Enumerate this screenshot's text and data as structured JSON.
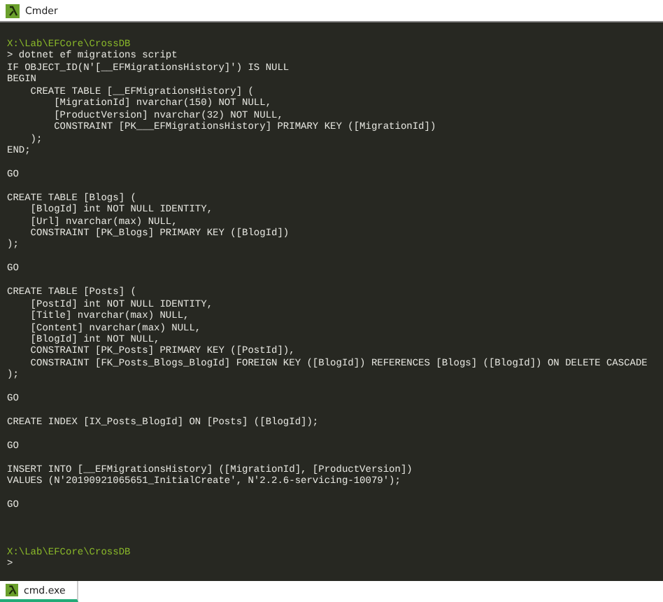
{
  "window": {
    "title": "Cmder"
  },
  "console": {
    "lines": [
      {
        "kind": "path",
        "text": "X:\\Lab\\EFCore\\CrossDB"
      },
      {
        "kind": "command",
        "text": "> dotnet ef migrations script"
      },
      {
        "kind": "output",
        "text": "IF OBJECT_ID(N'[__EFMigrationsHistory]') IS NULL"
      },
      {
        "kind": "output",
        "text": "BEGIN"
      },
      {
        "kind": "output",
        "text": "    CREATE TABLE [__EFMigrationsHistory] ("
      },
      {
        "kind": "output",
        "text": "        [MigrationId] nvarchar(150) NOT NULL,"
      },
      {
        "kind": "output",
        "text": "        [ProductVersion] nvarchar(32) NOT NULL,"
      },
      {
        "kind": "output",
        "text": "        CONSTRAINT [PK___EFMigrationsHistory] PRIMARY KEY ([MigrationId])"
      },
      {
        "kind": "output",
        "text": "    );"
      },
      {
        "kind": "output",
        "text": "END;"
      },
      {
        "kind": "blank"
      },
      {
        "kind": "output",
        "text": "GO"
      },
      {
        "kind": "blank"
      },
      {
        "kind": "output",
        "text": "CREATE TABLE [Blogs] ("
      },
      {
        "kind": "output",
        "text": "    [BlogId] int NOT NULL IDENTITY,"
      },
      {
        "kind": "output",
        "text": "    [Url] nvarchar(max) NULL,"
      },
      {
        "kind": "output",
        "text": "    CONSTRAINT [PK_Blogs] PRIMARY KEY ([BlogId])"
      },
      {
        "kind": "output",
        "text": ");"
      },
      {
        "kind": "blank"
      },
      {
        "kind": "output",
        "text": "GO"
      },
      {
        "kind": "blank"
      },
      {
        "kind": "output",
        "text": "CREATE TABLE [Posts] ("
      },
      {
        "kind": "output",
        "text": "    [PostId] int NOT NULL IDENTITY,"
      },
      {
        "kind": "output",
        "text": "    [Title] nvarchar(max) NULL,"
      },
      {
        "kind": "output",
        "text": "    [Content] nvarchar(max) NULL,"
      },
      {
        "kind": "output",
        "text": "    [BlogId] int NOT NULL,"
      },
      {
        "kind": "output",
        "text": "    CONSTRAINT [PK_Posts] PRIMARY KEY ([PostId]),"
      },
      {
        "kind": "output",
        "text": "    CONSTRAINT [FK_Posts_Blogs_BlogId] FOREIGN KEY ([BlogId]) REFERENCES [Blogs] ([BlogId]) ON DELETE CASCADE"
      },
      {
        "kind": "output",
        "text": ");"
      },
      {
        "kind": "blank"
      },
      {
        "kind": "output",
        "text": "GO"
      },
      {
        "kind": "blank"
      },
      {
        "kind": "output",
        "text": "CREATE INDEX [IX_Posts_BlogId] ON [Posts] ([BlogId]);"
      },
      {
        "kind": "blank"
      },
      {
        "kind": "output",
        "text": "GO"
      },
      {
        "kind": "blank"
      },
      {
        "kind": "output",
        "text": "INSERT INTO [__EFMigrationsHistory] ([MigrationId], [ProductVersion])"
      },
      {
        "kind": "output",
        "text": "VALUES (N'20190921065651_InitialCreate', N'2.2.6-servicing-10079');"
      },
      {
        "kind": "blank"
      },
      {
        "kind": "output",
        "text": "GO"
      },
      {
        "kind": "blank"
      },
      {
        "kind": "blank"
      },
      {
        "kind": "blank"
      },
      {
        "kind": "path",
        "text": "X:\\Lab\\EFCore\\CrossDB"
      },
      {
        "kind": "command",
        "text": ">"
      }
    ]
  },
  "tabs": [
    {
      "label": "cmd.exe",
      "selected": true
    }
  ]
}
